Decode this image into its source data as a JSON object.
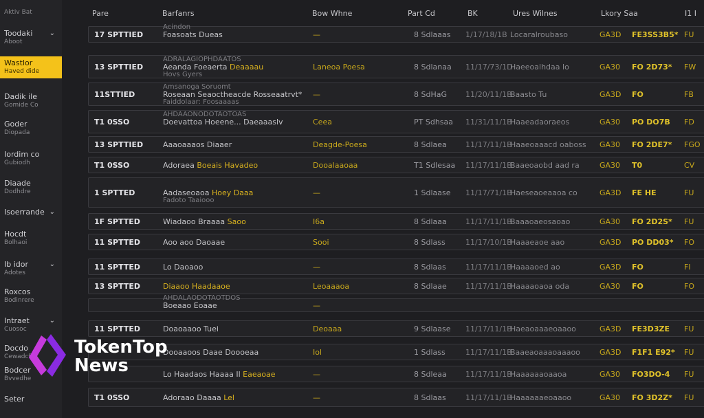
{
  "sidebar": {
    "top_label": "Aktiv Bat",
    "items": [
      {
        "label": "Toodaki",
        "sub": "Aboot",
        "chevron": "⌄",
        "active": false
      },
      {
        "label": "Wastlor",
        "sub": "Haved dide",
        "chevron": "",
        "active": true
      },
      {
        "label": "Dadik ile",
        "sub": "Gomide Co",
        "chevron": "",
        "active": false
      },
      {
        "label": "Goder",
        "sub": "Diopada",
        "chevron": "",
        "active": false
      },
      {
        "label": "Iordim co",
        "sub": "Gubiodh",
        "chevron": "",
        "active": false
      },
      {
        "label": "Diaade",
        "sub": "Dodhdre",
        "chevron": "",
        "active": false
      },
      {
        "label": "Isoerrande",
        "sub": "",
        "chevron": "⌄",
        "active": false
      },
      {
        "label": "Hocdt",
        "sub": "Bolhaoi",
        "chevron": "",
        "active": false
      },
      {
        "label": "Ib idor",
        "sub": "Adotes",
        "chevron": "⌄",
        "active": false
      },
      {
        "label": "Roxcos",
        "sub": "Bodinrere",
        "chevron": "",
        "active": false
      },
      {
        "label": "Intraet",
        "sub": "Cuosoc",
        "chevron": "⌄",
        "active": false
      },
      {
        "label": "Docdo",
        "sub": "Cewadcf",
        "chevron": "",
        "active": false
      },
      {
        "label": "Bodcer",
        "sub": "Bvvedhe",
        "chevron": "",
        "active": false
      },
      {
        "label": "Seter",
        "sub": "",
        "chevron": "",
        "active": false
      }
    ]
  },
  "headers": {
    "time": "Pare",
    "details": "Barfanrs",
    "bow": "Bow Whne",
    "pc": "Part Cd",
    "sk": "BK",
    "uw": "Ures Wilnes",
    "bs": "Lkory Saa",
    "ex": "I1 I"
  },
  "rows": [
    {
      "time": "17 SPTTIED",
      "d1": "Acindon",
      "d2": "Foasoats Dueas",
      "d2h": "",
      "d3": "",
      "bw": "—",
      "pc": "8 Sdlaaas",
      "sk": "1/17/18/1B",
      "uw": "Locaralroubaso",
      "pa": "GA3D",
      "bs": "FE3SS3B5*",
      "ex": "FU"
    },
    {
      "time": "13 SPTTIED",
      "d1": "ADRALAGIOPHDAATOS",
      "d2": "Aeanda Foeaerta ",
      "d2h": "Deaaaau",
      "d3": "Hovs Gyers",
      "bw": "Laneoa Poesa",
      "pc": "8 Sdlanaa",
      "sk": "11/17/73/1D",
      "uw": "Haeeoalhdaa lo",
      "pa": "GA30",
      "bs": "FO 2D73*",
      "ex": "FW"
    },
    {
      "time": "11STTIED",
      "d1": "Amsanoga Soruomt",
      "d2": "Roseaan Seaoctheacde Rosseaatrvt*",
      "d2h": "",
      "d3": "Faiddolaar: Foosaaaas",
      "bw": "—",
      "pc": "8 SdHaG",
      "sk": "11/20/11/1B",
      "uw": "Baasto Tu",
      "pa": "GA3D",
      "bs": "FO",
      "ex": "FB"
    },
    {
      "time": "T1 0SSO",
      "d1": "AHDAAONODOTAOTOAS",
      "d2": "Doevattoa Hoeene... Daeaaaslv",
      "d2h": "",
      "d3": "",
      "bw": "Ceea",
      "pc": "PT Sdhsaa",
      "sk": "11/31/11/1B",
      "uw": "Haaeadaoraeos",
      "pa": "GA30",
      "bs": "PO DO7B",
      "ex": "FD"
    },
    {
      "time": "13 SPTTIED",
      "d1": "",
      "d2": "Aaaoaaaos Diaaer",
      "d2h": "",
      "d3": "",
      "bw": "Deagde-Poesa",
      "pc": "8 Sdlaea",
      "sk": "11/17/11/1B",
      "uw": "Haaeoaaacd oaboss",
      "pa": "GA30",
      "bs": "FO 2DE7*",
      "ex": "FGO"
    },
    {
      "time": "T1 0SSO",
      "d1": "",
      "d2": "Adoraea ",
      "d2h": "Boeais Havadeo",
      "d3": "",
      "bw": "Dooalaaoaa",
      "pc": "T1 Sdlesaa",
      "sk": "11/17/11/1B",
      "uw": "Baaeoaobd aad ra",
      "pa": "GA30",
      "bs": "T0",
      "ex": "CV"
    },
    {
      "time": "1 SPTTED",
      "d1": "",
      "d2": "Aadaseoaoa ",
      "d2h": "Hoey Daaa",
      "d3": "Fadoto Taaiooo",
      "bw": "—",
      "pc": "1 Sdlaase",
      "sk": "11/17/71/1B",
      "uw": "Haeseaoeaaoa co",
      "pa": "GA3D",
      "bs": "FE HE",
      "ex": "FU"
    },
    {
      "time": "1F SPTTED",
      "d1": "",
      "d2": "Wiadaoo Braaaa ",
      "d2h": "Saoo",
      "d3": "",
      "bw": "I6a",
      "pc": "8 Sdlaaa",
      "sk": "11/17/11/1B",
      "uw": "Baaaoaeosaoao",
      "pa": "GA30",
      "bs": "FO 2D2S*",
      "ex": "FU"
    },
    {
      "time": "11 SPTTED",
      "d1": "",
      "d2": "Aoo aoo Daoaae",
      "d2h": "",
      "d3": "",
      "bw": "Sooi",
      "pc": "8 Sdlass",
      "sk": "11/17/10/1B",
      "uw": "Haaaeaoe aao",
      "pa": "GA3D",
      "bs": "PO DD03*",
      "ex": "FO"
    },
    {
      "time": "11 SPTTED",
      "d1": "",
      "d2": "Lo Daoaoo",
      "d2h": "",
      "d3": "",
      "bw": "—",
      "pc": "8 Sdlaas",
      "sk": "11/17/11/1B",
      "uw": "Haaaaoed ao",
      "pa": "GA3D",
      "bs": "FO",
      "ex": "FI"
    },
    {
      "time": "13 SPTTED",
      "d1": "",
      "d2": "",
      "d2h": "Diaaoo Haadaaoe",
      "d3": "",
      "bw": "Leoaaaoa",
      "pc": "8 Sdlaae",
      "sk": "11/17/11/1B",
      "uw": "Haaaaoaoa oda",
      "pa": "GA30",
      "bs": "FO",
      "ex": "FO"
    },
    {
      "time": "",
      "d1": "AHDALAODOTAOTDOS",
      "d2": "Boeaao Eoaae",
      "d2h": "",
      "d3": "",
      "bw": "—",
      "pc": "",
      "sk": "",
      "uw": "",
      "pa": "",
      "bs": "",
      "ex": ""
    },
    {
      "time": "11 SPTTED",
      "d1": "",
      "d2": "Doaoaaoo Tuei",
      "d2h": "",
      "d3": "",
      "bw": "Deoaaa",
      "pc": "9 Sdlaase",
      "sk": "11/17/11/1B",
      "uw": "Haeaoaaaeoaaoo",
      "pa": "GA3D",
      "bs": "FE3D3ZE",
      "ex": "FU"
    },
    {
      "time": "",
      "d1": "",
      "d2": "Dooaaoos Daae Doooeaa",
      "d2h": "",
      "d3": "",
      "bw": "Iol",
      "pc": "1 Sdlass",
      "sk": "11/17/11/1B",
      "uw": "Baaeaoaaaoaaaoo",
      "pa": "GA3D",
      "bs": "F1F1 E92*",
      "ex": "FU"
    },
    {
      "time": "",
      "d1": "",
      "d2": "Lo Haadaos Haaaa Il ",
      "d2h": "Eaeaoae",
      "d3": "",
      "bw": "—",
      "pc": "8 Sdleaa",
      "sk": "11/17/11/1B",
      "uw": "Haaaaaaoaaoa",
      "pa": "GA30",
      "bs": "FO3DO-4",
      "ex": "FU"
    },
    {
      "time": "T1 0SSO",
      "d1": "",
      "d2": "Adoraao Daaaa ",
      "d2h": "Lel",
      "d3": "",
      "bw": "—",
      "pc": "8 Sdlaas",
      "sk": "11/17/11/1B",
      "uw": "Haaaaaaeoaaoo",
      "pa": "GA30",
      "bs": "FO 3D2Z*",
      "ex": "FU"
    }
  ],
  "logo": {
    "line1": "TokenTop",
    "line2": "News"
  },
  "colors": {
    "accent": "#f4c21a",
    "background": "#1d1d20",
    "row_border": "#3a3a3f",
    "highlight_text": "#d9b21f"
  }
}
